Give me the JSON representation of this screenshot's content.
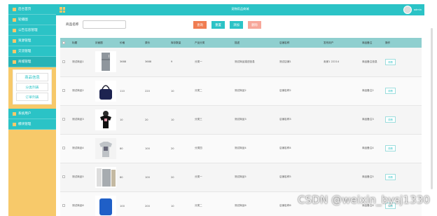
{
  "header": {
    "title": "宠物用品商城",
    "user": "admin"
  },
  "sidebar": {
    "items": [
      {
        "label": "后台首页"
      },
      {
        "label": "轮播图"
      },
      {
        "label": "公告信息管理"
      },
      {
        "label": "资源管理"
      },
      {
        "label": "交流管理"
      },
      {
        "label": "商城管理"
      }
    ],
    "sub_items": [
      {
        "label": "商品信息"
      },
      {
        "label": "分类列表"
      },
      {
        "label": "订单列表"
      }
    ],
    "bottom_items": [
      {
        "label": "系统用户"
      },
      {
        "label": "模块管理"
      }
    ]
  },
  "toolbar": {
    "search_label": "商品名称",
    "search_placeholder": "",
    "buttons": [
      {
        "label": "查询",
        "color": "#f07d52"
      },
      {
        "label": "重置",
        "color": "#2bc3c6"
      },
      {
        "label": "添加",
        "color": "#2bc3c6"
      },
      {
        "label": "删除",
        "color": "#f7a79a"
      }
    ]
  },
  "table": {
    "columns": [
      "",
      "标题",
      "封面图",
      "价格",
      "原价",
      "库存数量",
      "产品分类",
      "描述",
      "店铺名称",
      "发布用户",
      "商品备注",
      "操作"
    ],
    "rows": [
      {
        "title": "测试商品1",
        "image": "fridge",
        "price": "3688",
        "orig": "3688",
        "stock": "9",
        "category": "分类一",
        "desc": "测试商品描述信息",
        "shop": "测试店铺1",
        "user": "卖家1 22214",
        "note": "商品备注信息",
        "action": "详情"
      },
      {
        "title": "测试商品2",
        "image": "handbag",
        "price": "110",
        "orig": "220",
        "stock": "10",
        "category": "分类二",
        "desc": "测试商品2",
        "shop": "店铺名称2",
        "user": "",
        "note": "商品备注2",
        "action": "详情"
      },
      {
        "title": "测试商品3",
        "image": "tshirt",
        "price": "10",
        "orig": "20",
        "stock": "10",
        "category": "分类三",
        "desc": "测试商品3",
        "shop": "店铺名称3",
        "user": "",
        "note": "商品备注3",
        "action": "详情"
      },
      {
        "title": "测试商品4",
        "image": "shirt",
        "price": "80",
        "orig": "100",
        "stock": "20",
        "category": "分类四",
        "desc": "测试商品4",
        "shop": "店铺名称4",
        "user": "",
        "note": "商品备注4",
        "action": "详情"
      },
      {
        "title": "测试商品5",
        "image": "fridge2",
        "price": "80",
        "orig": "100",
        "stock": "20",
        "category": "分类一",
        "desc": "测试商品5",
        "shop": "店铺名称5",
        "user": "",
        "note": "商品备注5",
        "action": "详情"
      },
      {
        "title": "测试商品6",
        "image": "blue",
        "price": "100",
        "orig": "200",
        "stock": "10",
        "category": "分类二",
        "desc": "测试商品6",
        "shop": "店铺名称6",
        "user": "",
        "note": "商品备注6",
        "action": "详情"
      }
    ]
  },
  "watermark": "CSDN @weixin_bysj1330"
}
